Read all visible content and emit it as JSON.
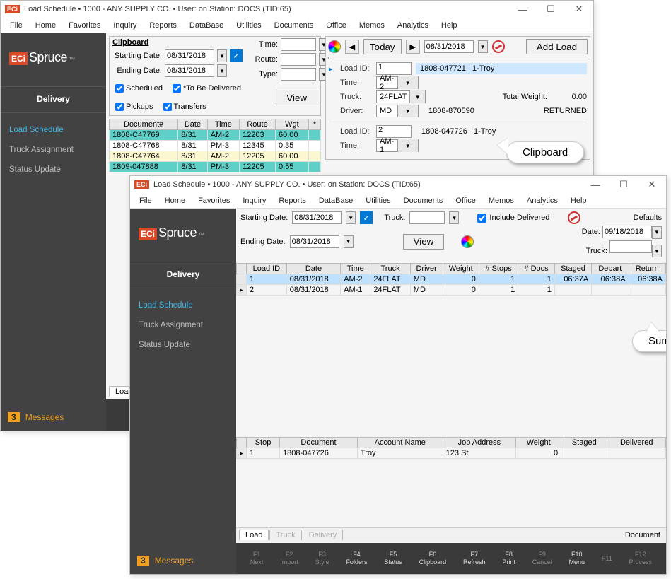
{
  "brand": {
    "eci": "ECi",
    "spruce": "Spruce",
    "tm": "™"
  },
  "menus": [
    "File",
    "Home",
    "Favorites",
    "Inquiry",
    "Reports",
    "DataBase",
    "Utilities",
    "Documents",
    "Office",
    "Memos",
    "Analytics",
    "Help"
  ],
  "sidebar": {
    "section": "Delivery",
    "items": [
      "Load Schedule",
      "Truck Assignment",
      "Status Update"
    ],
    "msg_count": "3",
    "msg_label": "Messages"
  },
  "callouts": {
    "clipboard": "Clipboard",
    "summary": "Summary"
  },
  "win1": {
    "title": "Load Schedule  •  1000 - ANY SUPPLY CO.  •  User:          on Station: DOCS (TID:65)",
    "clip": {
      "header": "Clipboard",
      "start_lbl": "Starting Date:",
      "start": "08/31/2018",
      "end_lbl": "Ending Date:",
      "end": "08/31/2018",
      "time_lbl": "Time:",
      "route_lbl": "Route:",
      "type_lbl": "Type:",
      "chk_scheduled": "Scheduled",
      "chk_tobedeliv": "*To Be Delivered",
      "chk_pickups": "Pickups",
      "chk_transfers": "Transfers",
      "view_btn": "View"
    },
    "toolbar": {
      "today": "Today",
      "date": "08/31/2018",
      "add_load": "Add Load"
    },
    "doc_cols": [
      "Document#",
      "Date",
      "Time",
      "Route",
      "Wgt",
      "*"
    ],
    "doc_rows": [
      {
        "cls": "row-cyan",
        "c": [
          "1808-C47769",
          "8/31",
          "AM-2",
          "12203",
          "60.00",
          ""
        ]
      },
      {
        "cls": "row-white",
        "c": [
          "1808-C47768",
          "8/31",
          "PM-3",
          "12345",
          "0.35",
          ""
        ]
      },
      {
        "cls": "row-yellow",
        "c": [
          "1808-C47764",
          "8/31",
          "AM-2",
          "12205",
          "60.00",
          ""
        ]
      },
      {
        "cls": "row-cyan",
        "c": [
          "1809-047888",
          "8/31",
          "PM-3",
          "12205",
          "0.55",
          ""
        ]
      }
    ],
    "load1": {
      "id_lbl": "Load ID:",
      "id": "1",
      "cust": "1808-047721",
      "custname": "1-Troy",
      "time_lbl": "Time:",
      "time": "AM-2",
      "truck_lbl": "Truck:",
      "truck": "24FLAT",
      "driver_lbl": "Driver:",
      "driver": "MD",
      "dcode": "1808-870590",
      "tw_lbl": "Total Weight:",
      "tw": "0.00",
      "status": "RETURNED"
    },
    "load2": {
      "id": "2",
      "cust": "1808-047726",
      "custname": "1-Troy",
      "time": "AM-1"
    },
    "tabs": [
      "Load",
      "Tru"
    ],
    "fn": [
      {
        "k": "F1",
        "t": "Next"
      }
    ]
  },
  "win2": {
    "title": "Load Schedule  •  1000 - ANY SUPPLY CO.  •  User:          on Station: DOCS (TID:65)",
    "flt": {
      "start_lbl": "Starting Date:",
      "start": "08/31/2018",
      "end_lbl": "Ending Date:",
      "end": "08/31/2018",
      "truck_lbl": "Truck:",
      "include": "Include Delivered",
      "view": "View",
      "defaults": "Defaults",
      "date_lbl": "Date:",
      "date": "09/18/2018",
      "dtruck_lbl": "Truck:"
    },
    "sum_cols": [
      "",
      "Load ID",
      "Date",
      "Time",
      "Truck",
      "Driver",
      "Weight",
      "# Stops",
      "# Docs",
      "Staged",
      "Depart",
      "Return"
    ],
    "sum_rows": [
      {
        "sel": true,
        "c": [
          "",
          "1",
          "08/31/2018",
          "AM-2",
          "24FLAT",
          "MD",
          "0",
          "1",
          "1",
          "06:37A",
          "06:38A",
          "06:38A"
        ]
      },
      {
        "sel": false,
        "c": [
          "▸",
          "2",
          "08/31/2018",
          "AM-1",
          "24FLAT",
          "MD",
          "0",
          "1",
          "1",
          "",
          "",
          ""
        ]
      }
    ],
    "stop_cols": [
      "",
      "Stop",
      "Document",
      "Account Name",
      "Job Address",
      "Weight",
      "Staged",
      "Delivered"
    ],
    "stop_rows": [
      {
        "c": [
          "▸",
          "1",
          "1808-047726",
          "Troy",
          "123 St",
          "0",
          "",
          ""
        ]
      }
    ],
    "tabs": [
      "Load",
      "Truck",
      "Delivery"
    ],
    "tabright": "Document",
    "fn": [
      {
        "k": "F1",
        "t": "Next",
        "on": 0
      },
      {
        "k": "F2",
        "t": "Import",
        "on": 0
      },
      {
        "k": "F3",
        "t": "Style",
        "on": 0
      },
      {
        "k": "F4",
        "t": "Folders",
        "on": 1
      },
      {
        "k": "F5",
        "t": "Status",
        "on": 1
      },
      {
        "k": "F6",
        "t": "Clipboard",
        "on": 1
      },
      {
        "k": "F7",
        "t": "Refresh",
        "on": 1
      },
      {
        "k": "F8",
        "t": "Print",
        "on": 1
      },
      {
        "k": "F9",
        "t": "Cancel",
        "on": 0
      },
      {
        "k": "F10",
        "t": "Menu",
        "on": 1
      },
      {
        "k": "F11",
        "t": "",
        "on": 0
      },
      {
        "k": "F12",
        "t": "Process",
        "on": 0
      }
    ]
  }
}
